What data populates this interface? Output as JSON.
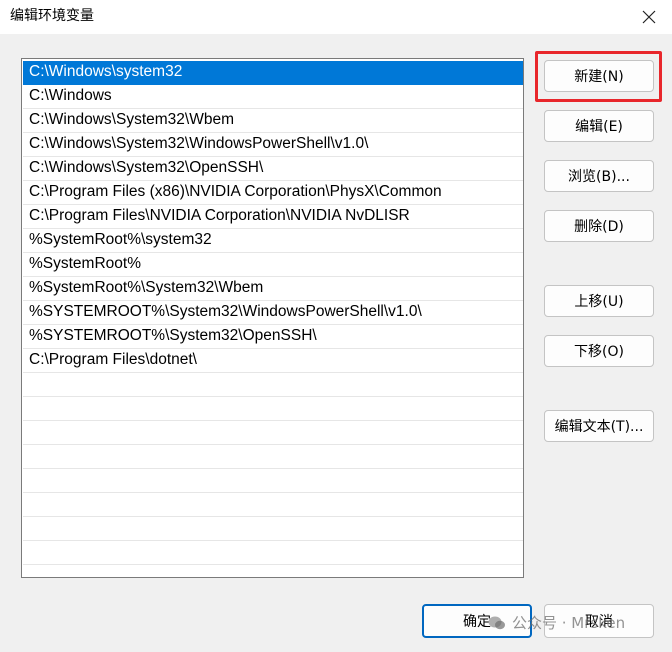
{
  "window": {
    "title": "编辑环境变量",
    "close_glyph": "✕"
  },
  "path_list": [
    "C:\\Windows\\system32",
    "C:\\Windows",
    "C:\\Windows\\System32\\Wbem",
    "C:\\Windows\\System32\\WindowsPowerShell\\v1.0\\",
    "C:\\Windows\\System32\\OpenSSH\\",
    "C:\\Program Files (x86)\\NVIDIA Corporation\\PhysX\\Common",
    "C:\\Program Files\\NVIDIA Corporation\\NVIDIA NvDLISR",
    "%SystemRoot%\\system32",
    "%SystemRoot%",
    "%SystemRoot%\\System32\\Wbem",
    "%SYSTEMROOT%\\System32\\WindowsPowerShell\\v1.0\\",
    "%SYSTEMROOT%\\System32\\OpenSSH\\",
    "C:\\Program Files\\dotnet\\"
  ],
  "selected_index": 0,
  "buttons": {
    "new": "新建(N)",
    "edit": "编辑(E)",
    "browse": "浏览(B)...",
    "delete": "删除(D)",
    "move_up": "上移(U)",
    "move_down": "下移(O)",
    "edit_text": "编辑文本(T)...",
    "ok": "确定",
    "cancel": "取消"
  },
  "watermark": {
    "text": "公众号 · Mrsken"
  },
  "colors": {
    "selection": "#0078d7",
    "highlight_box": "#e8262b",
    "default_button_border": "#0067c0"
  }
}
